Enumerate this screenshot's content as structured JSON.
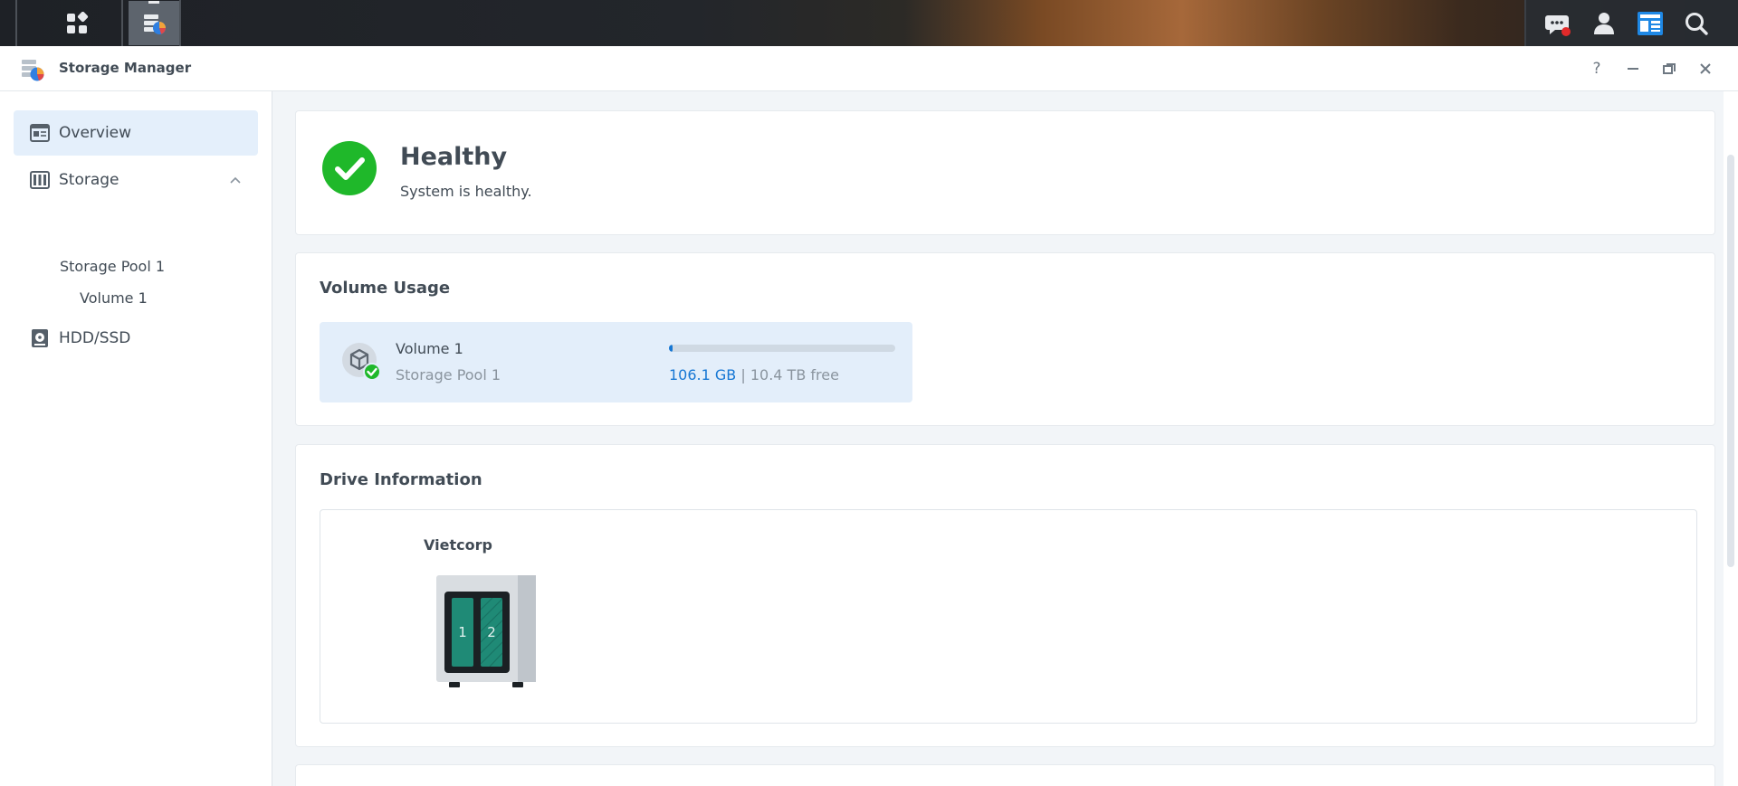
{
  "window": {
    "title": "Storage Manager",
    "help_label": "?"
  },
  "taskbar": {
    "left_icons": [
      "main-menu-icon",
      "storage-manager-app-icon"
    ],
    "right_icons": [
      "notification-icon",
      "user-icon",
      "widgets-icon",
      "search-icon"
    ]
  },
  "sidebar": {
    "items": [
      {
        "label": "Overview",
        "icon": "overview-icon",
        "selected": true
      },
      {
        "label": "Storage",
        "icon": "storage-icon",
        "expanded": true,
        "children": [
          {
            "label": "Storage Pool 1",
            "children": [
              {
                "label": "Volume 1"
              }
            ]
          }
        ]
      },
      {
        "label": "HDD/SSD",
        "icon": "hdd-icon"
      }
    ]
  },
  "status": {
    "title": "Healthy",
    "subtitle": "System is healthy."
  },
  "volume_usage": {
    "title": "Volume Usage",
    "volumes": [
      {
        "name": "Volume 1",
        "pool": "Storage Pool 1",
        "used": "106.1 GB",
        "separator": "|",
        "free": "10.4 TB free",
        "usage_fraction": 0.01
      }
    ]
  },
  "drive_info": {
    "title": "Drive Information",
    "device_name": "Vietcorp",
    "bays": [
      "1",
      "2"
    ]
  },
  "colors": {
    "accent": "#1677d4",
    "healthy": "#1fb82a",
    "selected_bg": "#e4effb",
    "drive_bay": "#1f8a76",
    "notification_dot": "#e22a2a"
  }
}
